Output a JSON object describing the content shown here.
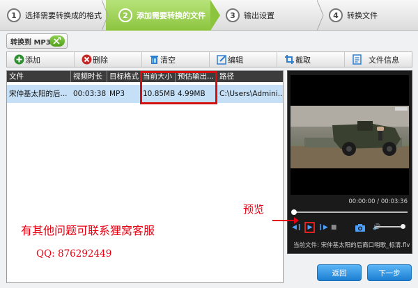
{
  "steps": [
    {
      "num": "1",
      "label": "选择需要转换成的格式"
    },
    {
      "num": "2",
      "label": "添加需要转换的文件"
    },
    {
      "num": "3",
      "label": "输出设置"
    },
    {
      "num": "4",
      "label": "转换文件"
    }
  ],
  "format_button": {
    "label": "转换到 MP3"
  },
  "toolbar": {
    "add": "添加",
    "delete": "删除",
    "clear": "清空",
    "edit": "编辑",
    "crop": "截取",
    "file_info": "文件信息"
  },
  "table": {
    "headers": [
      "文件",
      "视频时长",
      "目标格式",
      "当前大小",
      "预估输出...",
      "路径"
    ],
    "rows": [
      [
        "宋仲基太阳的后...",
        "00:03:38",
        "MP3",
        "10.85MB",
        "4.99MB",
        "C:\\Users\\Admini..."
      ]
    ]
  },
  "annotations": {
    "help_text": "有其他问题可联系狸窝客服",
    "qq_text": "QQ: 876292449",
    "preview_label": "预览"
  },
  "player": {
    "time": "00:00:00 / 00:03:36",
    "current_file": "当前文件: 宋仲基太阳的后裔口哨歌_标清.flv",
    "progress": 0
  },
  "buttons": {
    "back": "返回",
    "next": "下一步"
  },
  "colors": {
    "accent": "#8cc43e",
    "highlight": "#d21010",
    "annotation": "#e60012",
    "button": "#1d7fd3"
  }
}
